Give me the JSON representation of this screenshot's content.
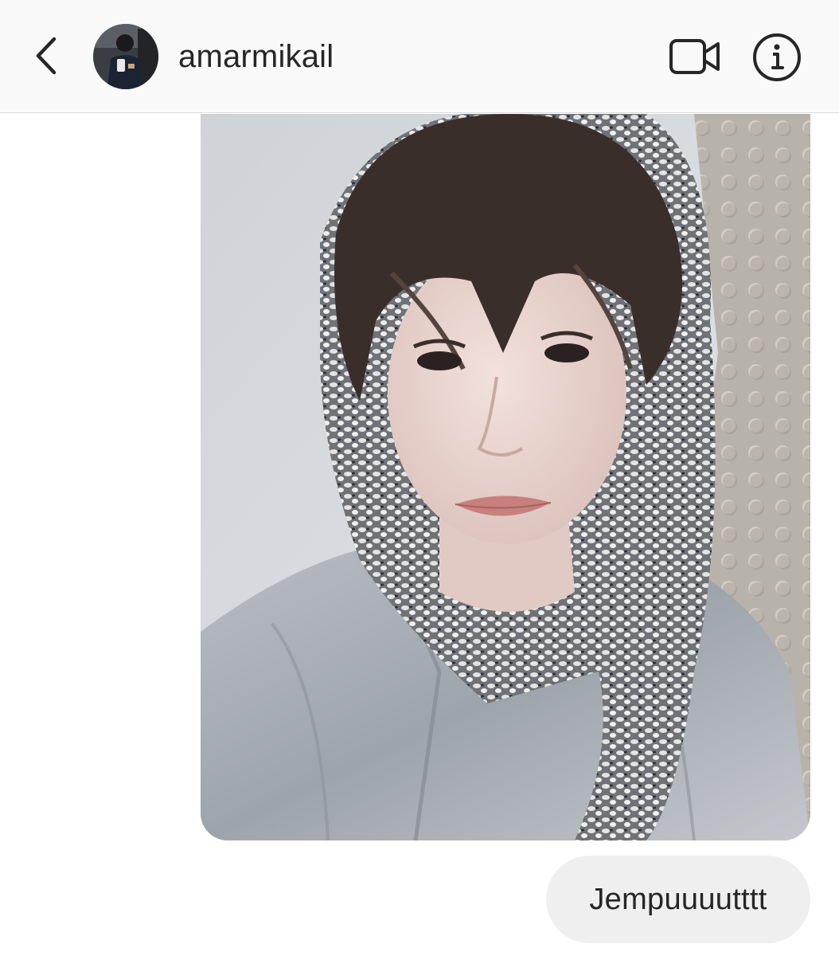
{
  "header": {
    "username": "amarmikail",
    "icons": {
      "back": "chevron-left-icon",
      "video": "video-camera-icon",
      "info": "info-icon"
    }
  },
  "messages": [
    {
      "type": "photo",
      "sender": "self",
      "content": "selfie photo of a person with a grey patterned scarf over the head and a grey jacket"
    },
    {
      "type": "text",
      "sender": "self",
      "text": "Jempuuuutttt"
    }
  ],
  "colors": {
    "header_bg": "#f9f9f9",
    "bubble_bg": "#efefef",
    "text": "#262626"
  }
}
